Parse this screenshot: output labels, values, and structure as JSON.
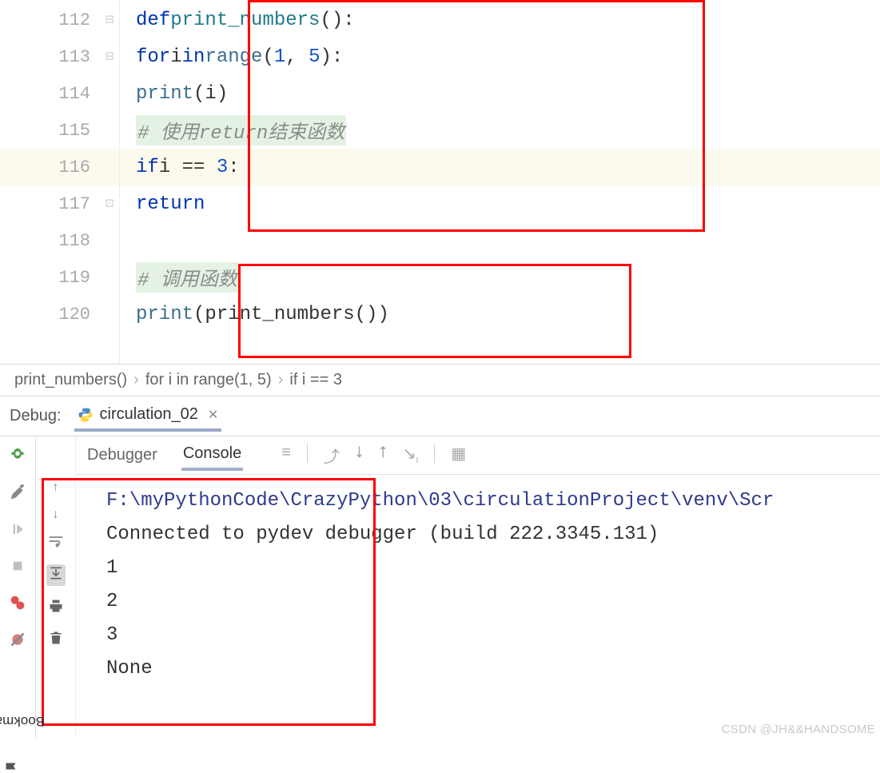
{
  "editor": {
    "lines": [
      {
        "num": "112"
      },
      {
        "num": "113"
      },
      {
        "num": "114"
      },
      {
        "num": "115"
      },
      {
        "num": "116"
      },
      {
        "num": "117"
      },
      {
        "num": "118"
      },
      {
        "num": "119"
      },
      {
        "num": "120"
      }
    ],
    "code": {
      "l112": {
        "kw_def": "def",
        "fn_name": "print_numbers",
        "parens": "():"
      },
      "l113": {
        "kw_for": "for",
        "var": "i",
        "kw_in": "in",
        "fn_range": "range",
        "args": "(",
        "n1": "1",
        "comma": ", ",
        "n2": "5",
        "close": "):"
      },
      "l114": {
        "fn_print": "print",
        "args": "(i)"
      },
      "l115": {
        "comment": "# 使用return结束函数"
      },
      "l116": {
        "kw_if": "if",
        "var": "i",
        "op": " == ",
        "n": "3",
        "colon": ":"
      },
      "l117": {
        "kw_return": "return"
      },
      "l119": {
        "comment": "# 调用函数"
      },
      "l120": {
        "fn_print": "print",
        "open": "(",
        "fn_call": "print_numbers",
        "close": "())"
      }
    }
  },
  "breadcrumb": {
    "items": [
      "print_numbers()",
      "for i in range(1, 5)",
      "if i == 3"
    ]
  },
  "debug": {
    "label": "Debug:",
    "tab": "circulation_02"
  },
  "console": {
    "tabs": {
      "debugger": "Debugger",
      "console": "Console"
    },
    "output": {
      "path": "F:\\myPythonCode\\CrazyPython\\03\\circulationProject\\venv\\Scr",
      "connected": "Connected to pydev debugger (build 222.3345.131)",
      "l1": "1",
      "l2": "2",
      "l3": "3",
      "l4": "None"
    }
  },
  "sidebar": {
    "bookmarks": "Bookmarks"
  },
  "watermark": "CSDN @JH&&HANDSOME"
}
